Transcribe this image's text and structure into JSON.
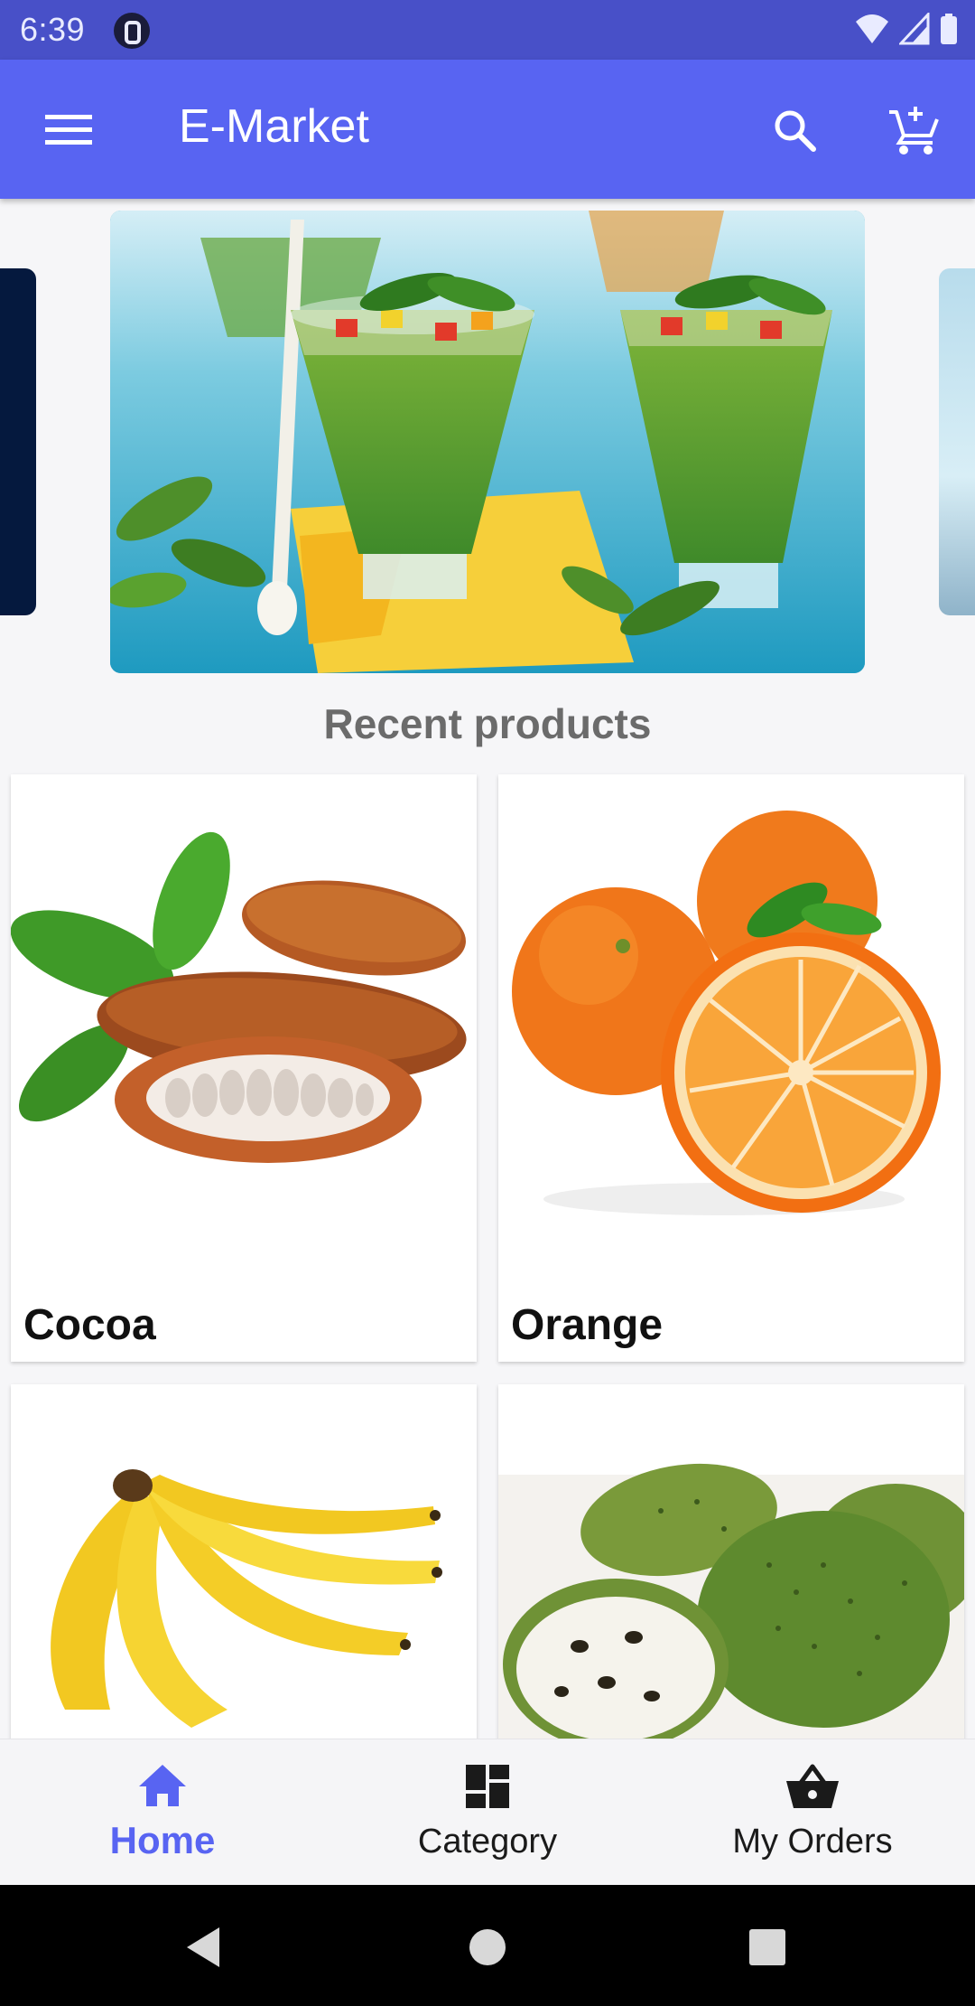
{
  "status_bar": {
    "time": "6:39"
  },
  "app_bar": {
    "title": "E-Market",
    "icons": [
      "menu-icon",
      "search-icon",
      "add-shopping-cart-icon"
    ]
  },
  "section": {
    "title": "Recent products"
  },
  "products": [
    {
      "name": "Cocoa"
    },
    {
      "name": "Orange"
    },
    {
      "name": ""
    },
    {
      "name": ""
    }
  ],
  "bottom_nav": {
    "items": [
      {
        "label": "Home",
        "icon": "home-icon",
        "active": true
      },
      {
        "label": "Category",
        "icon": "dashboard-icon",
        "active": false
      },
      {
        "label": "My Orders",
        "icon": "shopping-basket-icon",
        "active": false
      }
    ]
  },
  "colors": {
    "status_bar": "#4850c8",
    "primary": "#5864f2",
    "active_nav": "#5864f2"
  }
}
